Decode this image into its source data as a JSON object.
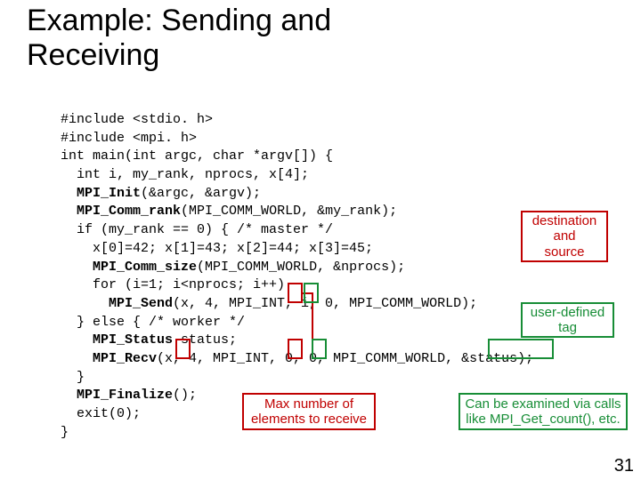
{
  "title_line1": "Example: Sending and",
  "title_line2": "Receiving",
  "code": {
    "l01": "#include <stdio. h> ",
    "l02": "#include <mpi. h>",
    "l03": "int main(int argc, char *argv[]) {",
    "l04": "  int i, my_rank, nprocs, x[4];",
    "l05a": "  ",
    "l05b": "MPI_Init",
    "l05c": "(&argc, &argv);",
    "l06a": "  ",
    "l06b": "MPI_Comm_rank",
    "l06c": "(MPI_COMM_WORLD, &my_rank);",
    "l07": "  if (my_rank == 0) { /* master */",
    "l08": "    x[0]=42; x[1]=43; x[2]=44; x[3]=45;",
    "l09a": "    ",
    "l09b": "MPI_Comm_size",
    "l09c": "(MPI_COMM_WORLD, &nprocs);",
    "l10": "    for (i=1; i<nprocs; i++)",
    "l11a": "      ",
    "l11b": "MPI_Send",
    "l11c": "(x, 4, MPI_INT, i, 0, MPI_COMM_WORLD);",
    "l12": "  } else { /* worker */",
    "l13a": "    ",
    "l13b": "MPI_Status",
    "l13c": " status;",
    "l14a": "    ",
    "l14b": "MPI_Recv",
    "l14c": "(x, 4, MPI_INT, 0, 0, MPI_COMM_WORLD, &status);",
    "l15": "  }",
    "l16a": "  ",
    "l16b": "MPI_Finalize",
    "l16c": "();",
    "l17": "  exit(0);",
    "l18": "}"
  },
  "labels": {
    "dest_src": "destination\nand\nsource",
    "tag": "user-defined\ntag",
    "max": "Max number of\nelements to receive",
    "status": "Can be examined via calls\nlike MPI_Get_count(), etc."
  },
  "pagenum": "31"
}
